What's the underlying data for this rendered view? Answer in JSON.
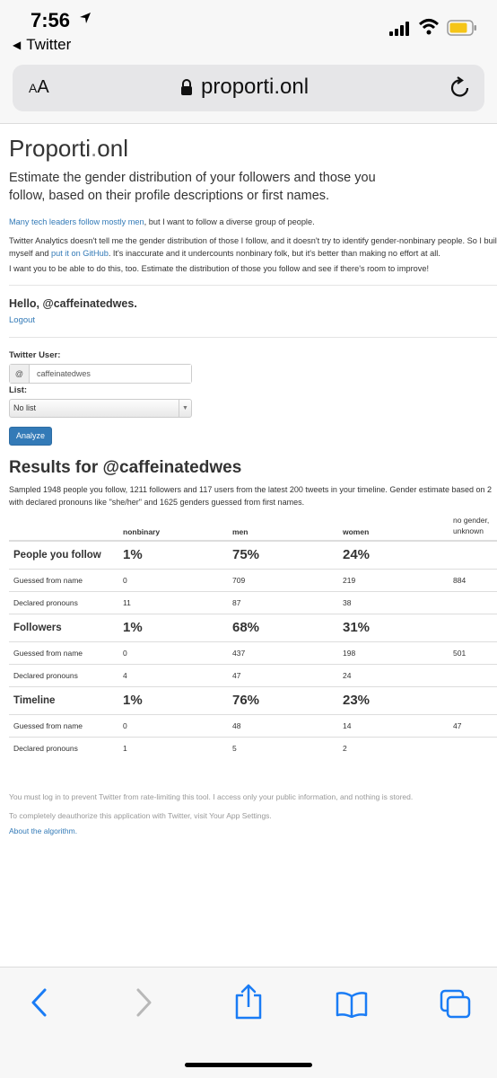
{
  "status_bar": {
    "time": "7:56",
    "back_app": "Twitter"
  },
  "browser": {
    "text_size_label": "AA",
    "domain": "proporti.onl"
  },
  "site": {
    "title_part1": "Proporti",
    "title_dot": ".",
    "title_part2": "onl",
    "tagline": "Estimate the gender distribution of your followers and those you follow, based on their profile descriptions or first names."
  },
  "intro": {
    "p1_link": "Many tech leaders follow mostly men",
    "p1_rest": ", but I want to follow a diverse group of people.",
    "p2_line1": "Twitter Analytics doesn't tell me the gender distribution of those I follow, and it doesn't try to identify gender-nonbinary people. So I buil",
    "p2_line2_a": "myself and ",
    "p2_line2_link": "put it on GitHub",
    "p2_line2_b": ". It's inaccurate and it undercounts nonbinary folk, but it's better than making no effort at all.",
    "p3": "I want you to be able to do this, too. Estimate the distribution of those you follow and see if there's room to improve!"
  },
  "account": {
    "hello": "Hello, @caffeinatedwes.",
    "logout": "Logout"
  },
  "form": {
    "user_label": "Twitter User:",
    "at_symbol": "@",
    "user_value": "caffeinatedwes",
    "list_label": "List:",
    "list_value": "No list",
    "submit_label": "Analyze"
  },
  "results": {
    "title": "Results for @caffeinatedwes",
    "summary_line1": "Sampled 1948 people you follow, 1211 followers and 117 users from the latest 200 tweets in your timeline. Gender estimate based on 2",
    "summary_line2": "with declared pronouns like \"she/her\" and 1625 genders guessed from first names.",
    "columns": [
      "",
      "nonbinary",
      "men",
      "women",
      "no gender, unknown"
    ],
    "sections": [
      {
        "name": "People you follow",
        "percent": [
          "1%",
          "75%",
          "24%",
          ""
        ],
        "guessed": [
          "Guessed from name",
          "0",
          "709",
          "219",
          "884"
        ],
        "declared": [
          "Declared pronouns",
          "11",
          "87",
          "38",
          ""
        ]
      },
      {
        "name": "Followers",
        "percent": [
          "1%",
          "68%",
          "31%",
          ""
        ],
        "guessed": [
          "Guessed from name",
          "0",
          "437",
          "198",
          "501"
        ],
        "declared": [
          "Declared pronouns",
          "4",
          "47",
          "24",
          ""
        ]
      },
      {
        "name": "Timeline",
        "percent": [
          "1%",
          "76%",
          "23%",
          ""
        ],
        "guessed": [
          "Guessed from name",
          "0",
          "48",
          "14",
          "47"
        ],
        "declared": [
          "Declared pronouns",
          "1",
          "5",
          "2",
          ""
        ]
      }
    ]
  },
  "footer": {
    "login_note": "You must log in to prevent Twitter from rate-limiting this tool. I access only your public information, and nothing is stored.",
    "deauth_note": "To completely deauthorize this application with Twitter, visit Your App Settings.",
    "algorithm_link": "About the algorithm."
  },
  "icons": {
    "toolbar": [
      "back-arrow-icon",
      "forward-arrow-icon",
      "share-icon",
      "bookmarks-icon",
      "tabs-icon"
    ],
    "accent": "#337ab7",
    "safari_tint": "#1a7cf5"
  }
}
